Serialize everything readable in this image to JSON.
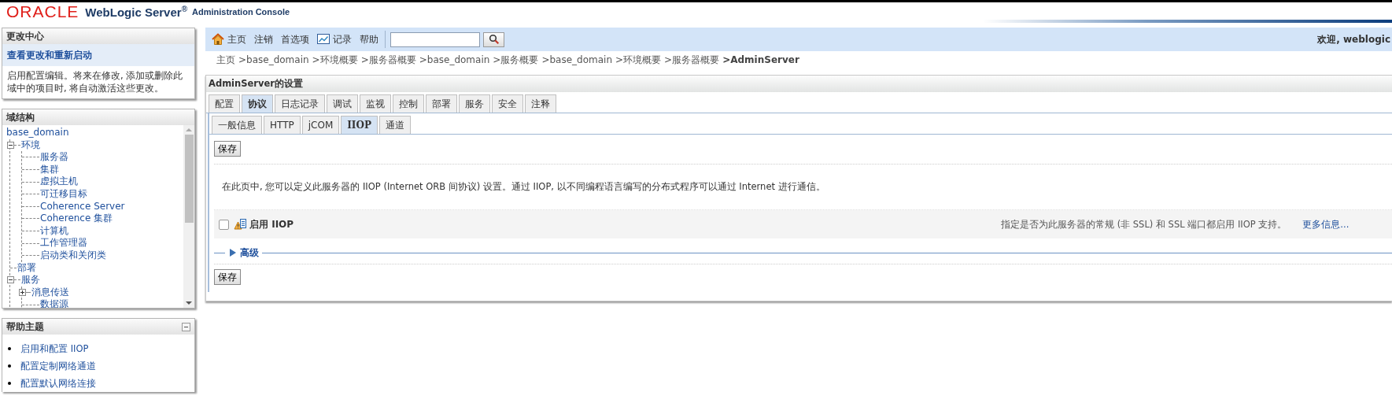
{
  "header": {
    "brand": "ORACLE",
    "product": "WebLogic Server$^{®}$",
    "subtitle": "Administration Console"
  },
  "change_center": {
    "title": "更改中心",
    "link": "查看更改和重新启动",
    "message": "启用配置编辑。将来在修改, 添加或删除此域中的项目时, 将自动激活这些更改。"
  },
  "domain_structure": {
    "title": "域结构",
    "root": "base_domain",
    "children": [
      {
        "label": "环境",
        "expanded": true,
        "children": [
          {
            "label": "服务器"
          },
          {
            "label": "集群"
          },
          {
            "label": "虚拟主机"
          },
          {
            "label": "可迁移目标"
          },
          {
            "label": "Coherence Server"
          },
          {
            "label": "Coherence 集群"
          },
          {
            "label": "计算机"
          },
          {
            "label": "工作管理器"
          },
          {
            "label": "启动类和关闭类"
          }
        ]
      },
      {
        "label": "部署"
      },
      {
        "label": "服务",
        "expanded": true,
        "children": [
          {
            "label": "消息传送",
            "expanded": false
          },
          {
            "label": "数据源"
          }
        ]
      }
    ]
  },
  "help_topics": {
    "title": "帮助主题",
    "items": [
      "启用和配置 IIOP",
      "配置定制网络通道",
      "配置默认网络连接"
    ]
  },
  "toolbar": {
    "items": [
      {
        "label": "主页",
        "kind": "home"
      },
      {
        "label": "注销",
        "kind": "plain"
      },
      {
        "label": "首选项",
        "kind": "plain"
      },
      {
        "label": "记录",
        "kind": "record"
      },
      {
        "label": "帮助",
        "kind": "plain"
      }
    ],
    "welcome": "欢迎, weblogic"
  },
  "breadcrumb": [
    "主页",
    ">base_domain",
    ">环境概要",
    ">服务器概要",
    ">base_domain",
    ">服务概要",
    ">base_domain",
    ">环境概要",
    ">服务器概要",
    ">AdminServer"
  ],
  "panel": {
    "title": "AdminServer的设置",
    "tabs": [
      {
        "label": "配置",
        "selected": false
      },
      {
        "label": "协议",
        "selected": true
      },
      {
        "label": "日志记录",
        "selected": false
      },
      {
        "label": "调试",
        "selected": false
      },
      {
        "label": "监视",
        "selected": false
      },
      {
        "label": "控制",
        "selected": false
      },
      {
        "label": "部署",
        "selected": false
      },
      {
        "label": "服务",
        "selected": false
      },
      {
        "label": "安全",
        "selected": false
      },
      {
        "label": "注释",
        "selected": false
      }
    ],
    "subtabs": [
      {
        "label": "一般信息",
        "selected": false
      },
      {
        "label": "HTTP",
        "selected": false
      },
      {
        "label": "jCOM",
        "selected": false
      },
      {
        "label": "IIOP",
        "selected": true
      },
      {
        "label": "通道",
        "selected": false
      }
    ],
    "save_top": "保存",
    "description": "在此页中, 您可以定义此服务器的 IIOP (Internet ORB 间协议) 设置。通过 IIOP, 以不同编程语言编写的分布式程序可以通过 Internet 进行通信。",
    "fields": [
      {
        "label": "启用 IIOP",
        "checked": false,
        "help": "指定是否为此服务器的常规 (非 SSL) 和 SSL 端口都启用 IIOP 支持。",
        "more": "更多信息..."
      }
    ],
    "advanced": {
      "label": "高级",
      "expanded": false
    },
    "save_bottom": "保存"
  }
}
